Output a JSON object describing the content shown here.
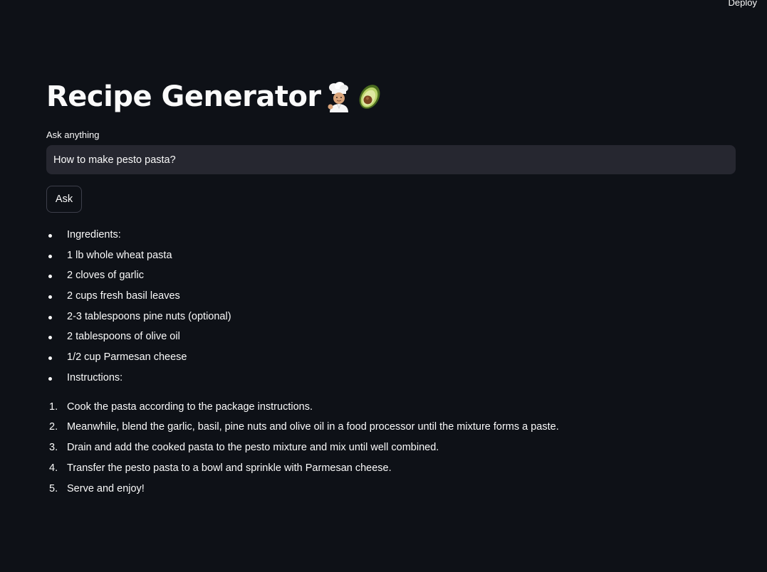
{
  "header": {
    "deploy_label": "Deploy"
  },
  "main": {
    "title": "Recipe Generator",
    "title_emojis": [
      "chef-icon",
      "avocado-icon"
    ],
    "input": {
      "label": "Ask anything",
      "value": "How to make pesto pasta?"
    },
    "ask_button_label": "Ask"
  },
  "response": {
    "bullets": [
      "Ingredients:",
      "1 lb whole wheat pasta",
      "2 cloves of garlic",
      "2 cups fresh basil leaves",
      "2-3 tablespoons pine nuts (optional)",
      "2 tablespoons of olive oil",
      "1/2 cup Parmesan cheese",
      "Instructions:"
    ],
    "steps": [
      {
        "num": "1.",
        "text": "Cook the pasta according to the package instructions."
      },
      {
        "num": "2.",
        "text": "Meanwhile, blend the garlic, basil, pine nuts and olive oil in a food processor until the mixture forms a paste."
      },
      {
        "num": "3.",
        "text": "Drain and add the cooked pasta to the pesto mixture and mix until well combined."
      },
      {
        "num": "4.",
        "text": "Transfer the pesto pasta to a bowl and sprinkle with Parmesan cheese."
      },
      {
        "num": "5.",
        "text": "Serve and enjoy!"
      }
    ]
  },
  "colors": {
    "background": "#0e1117",
    "input_background": "#262730",
    "text": "#fafafa"
  }
}
